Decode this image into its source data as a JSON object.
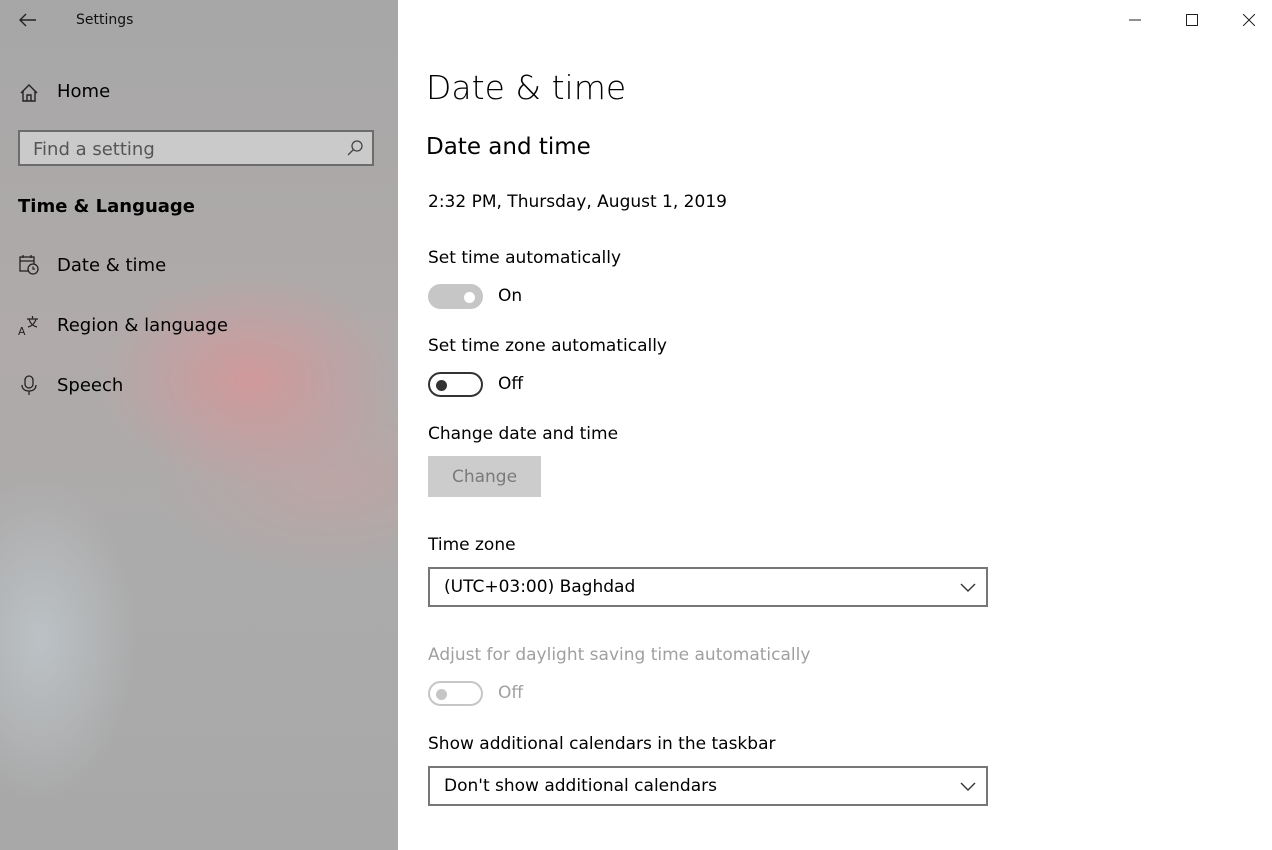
{
  "window": {
    "app_title": "Settings",
    "back_icon": "back-arrow-icon",
    "controls": [
      "minimize-icon",
      "maximize-icon",
      "close-icon"
    ]
  },
  "sidebar": {
    "home_label": "Home",
    "search_placeholder": "Find a setting",
    "section_title": "Time & Language",
    "items": [
      {
        "label": "Date & time",
        "icon": "calendar-clock-icon"
      },
      {
        "label": "Region & language",
        "icon": "language-icon"
      },
      {
        "label": "Speech",
        "icon": "microphone-icon"
      }
    ]
  },
  "main": {
    "page_title": "Date & time",
    "section_title": "Date and time",
    "current_datetime": "2:32 PM, Thursday, August 1, 2019",
    "set_time_auto": {
      "label": "Set time automatically",
      "state": "On",
      "enabled": false,
      "on": true
    },
    "set_timezone_auto": {
      "label": "Set time zone automatically",
      "state": "Off",
      "enabled": true,
      "on": false
    },
    "change_datetime": {
      "label": "Change date and time",
      "button": "Change"
    },
    "time_zone": {
      "label": "Time zone",
      "value": "(UTC+03:00) Baghdad"
    },
    "daylight_saving": {
      "label": "Adjust for daylight saving time automatically",
      "state": "Off",
      "enabled": false,
      "on": false
    },
    "additional_calendars": {
      "label": "Show additional calendars in the taskbar",
      "value": "Don't show additional calendars"
    }
  }
}
